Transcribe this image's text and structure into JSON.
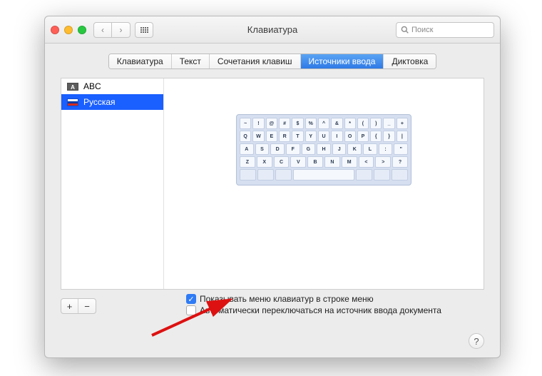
{
  "title": "Клавиатура",
  "search_placeholder": "Поиск",
  "tabs": [
    "Клавиатура",
    "Текст",
    "Сочетания клавиш",
    "Источники ввода",
    "Диктовка"
  ],
  "active_tab": 3,
  "sources": [
    {
      "icon": "A",
      "label": "ABC",
      "selected": false
    },
    {
      "icon": "ru",
      "label": "Русская",
      "selected": true
    }
  ],
  "keyboard_rows": [
    [
      "~",
      "!",
      "@",
      "#",
      "$",
      "%",
      "^",
      "&",
      "*",
      "(",
      ")",
      "_",
      "+"
    ],
    [
      "Q",
      "W",
      "E",
      "R",
      "T",
      "Y",
      "U",
      "I",
      "O",
      "P",
      "{",
      "}",
      "|"
    ],
    [
      "A",
      "S",
      "D",
      "F",
      "G",
      "H",
      "J",
      "K",
      "L",
      ":",
      "\""
    ],
    [
      "Z",
      "X",
      "C",
      "V",
      "B",
      "N",
      "M",
      "<",
      ">",
      "?"
    ]
  ],
  "add_label": "+",
  "remove_label": "−",
  "check1": "Показывать меню клавиатур в строке меню",
  "check2": "Автоматически переключаться на источник ввода документа",
  "help_label": "?"
}
